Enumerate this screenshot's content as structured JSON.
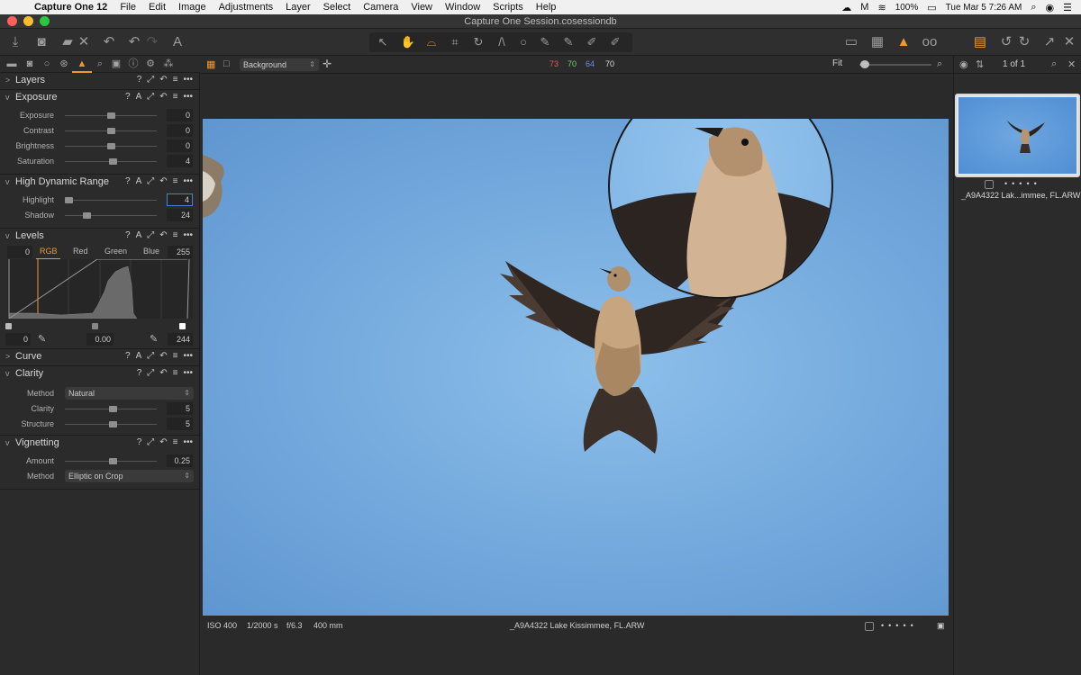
{
  "menubar": {
    "app_name": "Capture One 12",
    "items": [
      "File",
      "Edit",
      "Image",
      "Adjustments",
      "Layer",
      "Select",
      "Camera",
      "View",
      "Window",
      "Scripts",
      "Help"
    ],
    "battery": "100%",
    "datetime": "Tue Mar 5  7:26 AM"
  },
  "window": {
    "title": "Capture One Session.cosessiondb"
  },
  "accent_color": "#f29634",
  "tools": {
    "layers": {
      "title": "Layers"
    },
    "exposure": {
      "title": "Exposure",
      "rows": [
        {
          "label": "Exposure",
          "value": "0",
          "level": 0.5
        },
        {
          "label": "Contrast",
          "value": "0",
          "level": 0.5
        },
        {
          "label": "Brightness",
          "value": "0",
          "level": 0.5
        },
        {
          "label": "Saturation",
          "value": "4",
          "level": 0.52
        }
      ]
    },
    "hdr": {
      "title": "High Dynamic Range",
      "rows": [
        {
          "label": "Highlight",
          "value": "4",
          "level": 0.04
        },
        {
          "label": "Shadow",
          "value": "24",
          "level": 0.24
        }
      ]
    },
    "levels": {
      "title": "Levels",
      "input_low": "0",
      "input_high": "255",
      "tabs": [
        "RGB",
        "Red",
        "Green",
        "Blue"
      ],
      "output_low": "0",
      "midpoint": "0.00",
      "output_high": "244"
    },
    "curve": {
      "title": "Curve"
    },
    "clarity": {
      "title": "Clarity",
      "method_label": "Method",
      "method_value": "Natural",
      "rows": [
        {
          "label": "Clarity",
          "value": "5",
          "level": 0.52
        },
        {
          "label": "Structure",
          "value": "5",
          "level": 0.52
        }
      ]
    },
    "vignetting": {
      "title": "Vignetting",
      "rows": [
        {
          "label": "Amount",
          "value": "0.25",
          "level": 0.52
        }
      ],
      "method_label": "Method",
      "method_value": "Elliptic on Crop"
    },
    "header_icons": [
      "?",
      "A",
      "⤢",
      "↶",
      "≡",
      "•••"
    ]
  },
  "viewer": {
    "style_select": "Background",
    "readout": {
      "r": "73",
      "g": "70",
      "b": "64",
      "l": "70"
    },
    "readout_colors": {
      "r": "#e65a5a",
      "g": "#6fd06f",
      "b": "#6f8fe6"
    },
    "zoom_label": "Fit",
    "info": {
      "iso": "ISO 400",
      "shutter": "1/2000 s",
      "aperture": "f/6.3",
      "focal": "400 mm",
      "filename": "_A9A4322 Lake Kissimmee, FL.ARW"
    }
  },
  "browser": {
    "count": "1 of 1",
    "thumb_name": "_A9A4322 Lak...immee, FL.ARW"
  }
}
